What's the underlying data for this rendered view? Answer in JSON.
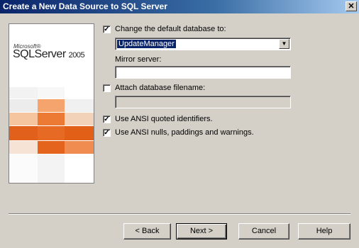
{
  "window": {
    "title": "Create a New Data Source to SQL Server",
    "close_glyph": "✕"
  },
  "logo": {
    "small": "Microsoft®",
    "product": "SQLServer",
    "year": "2005"
  },
  "options": {
    "change_db": {
      "label": "Change the default database to:",
      "checked": true
    },
    "database_value": "UpdateManager",
    "mirror_label": "Mirror server:",
    "mirror_value": "",
    "attach": {
      "label": "Attach database filename:",
      "checked": false
    },
    "attach_value": "",
    "ansi_quoted": {
      "label": "Use ANSI quoted identifiers.",
      "checked": true
    },
    "ansi_nulls": {
      "label": "Use ANSI nulls, paddings and warnings.",
      "checked": true
    }
  },
  "buttons": {
    "back": "< Back",
    "next": "Next >",
    "cancel": "Cancel",
    "help": "Help"
  },
  "colors": {
    "title_gradient_start": "#0a246a",
    "selection": "#0a246a",
    "orange_dark": "#e0601c",
    "orange_light": "#f4a46c"
  }
}
